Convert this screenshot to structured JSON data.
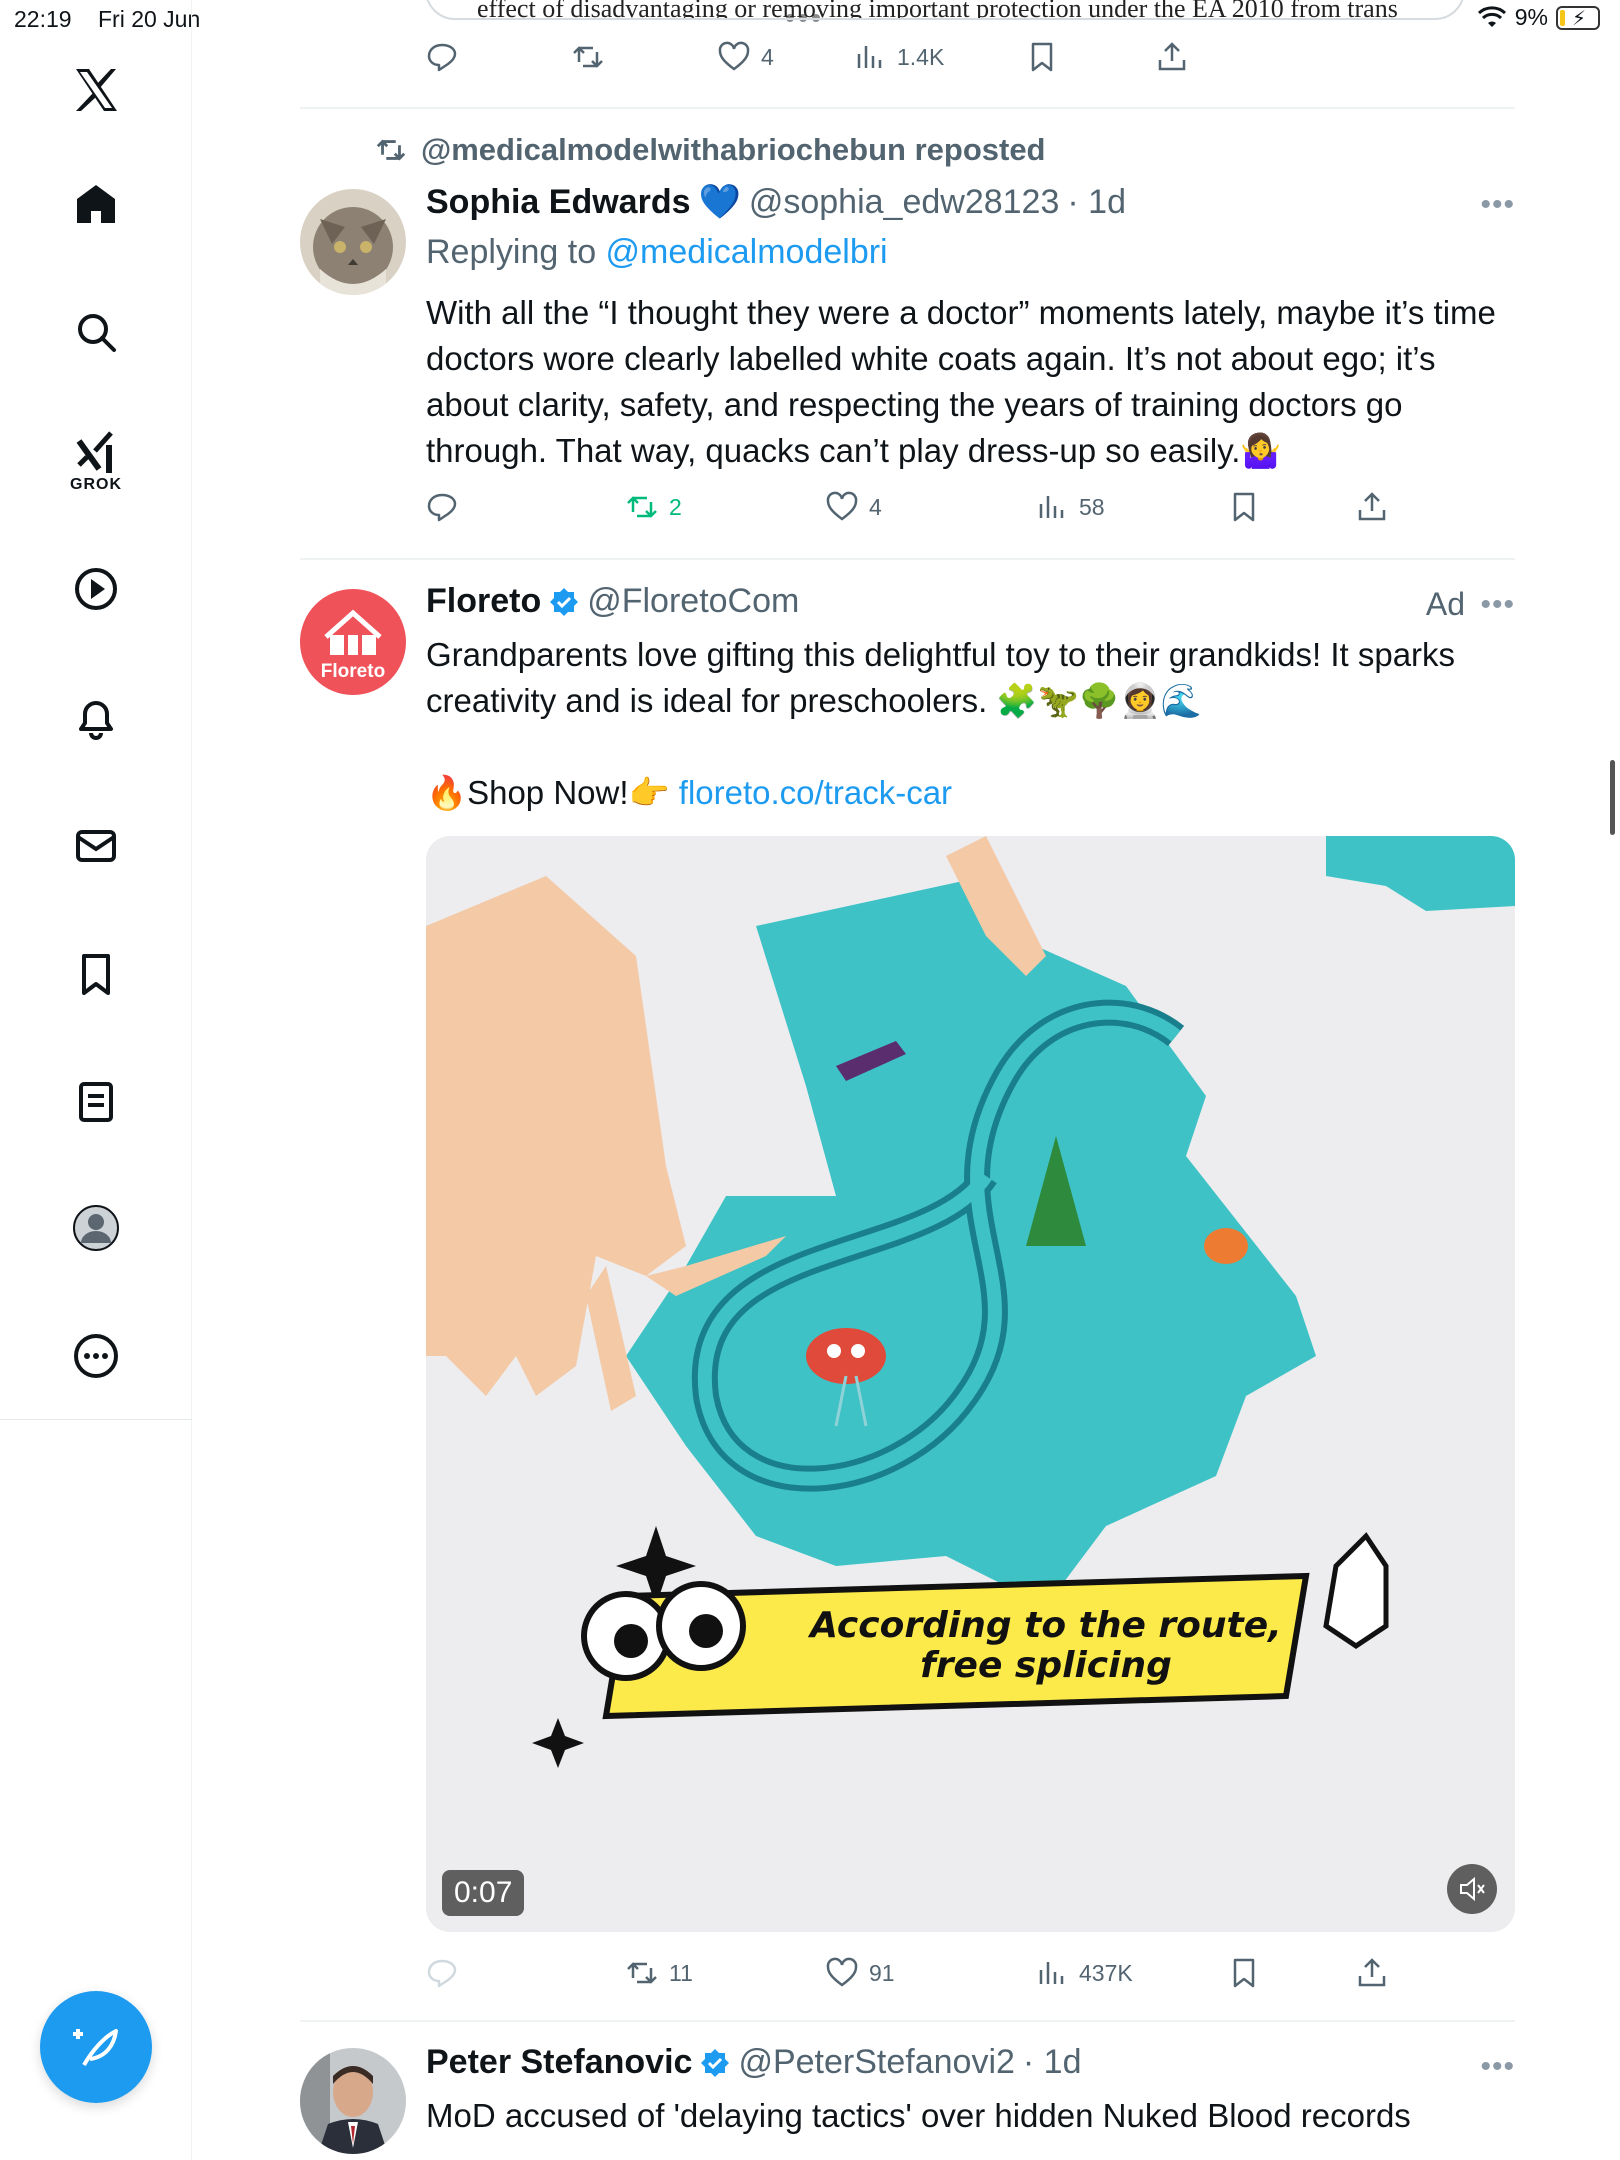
{
  "status_bar": {
    "time": "22:19",
    "date": "Fri 20 Jun",
    "battery": "9%"
  },
  "sidebar": {
    "grok_label": "GROK"
  },
  "previous_tweet": {
    "card_text": "effect of disadvantaging or removing important protection under the EA 2010 from trans",
    "likes": "4",
    "views": "1.4K"
  },
  "tweet1": {
    "reposted_by": "@medicalmodelwithabriochebun reposted",
    "name": "Sophia Edwards",
    "name_emoji": "💙",
    "handle": "@sophia_edw28123",
    "time": "· 1d",
    "replying_prefix": "Replying to ",
    "replying_to": "@medicalmodelbri",
    "text": "With all the “I thought they were a doctor” moments lately, maybe it’s time doctors wore clearly labelled white coats again. It’s not about ego; it’s about clarity, safety, and respecting the years of training doctors go through. That way, quacks can’t play dress-up so easily.🤷‍♀️",
    "reposts": "2",
    "likes": "4",
    "views": "58"
  },
  "ad_tweet": {
    "name": "Floreto",
    "handle": "@FloretoCom",
    "ad_label": "Ad",
    "avatar_text": "Floreto",
    "text": "Grandparents love gifting this delightful toy to their grandkids! It sparks creativity and is ideal for preschoolers. 🧩🦖🌳👩‍🚀🌊",
    "cta": "🔥Shop Now!👉 ",
    "link": "floreto.co/track-car",
    "video_caption": "According to the route, free splicing",
    "video_time": "0:07",
    "reposts": "11",
    "likes": "91",
    "views": "437K"
  },
  "tweet3": {
    "name": "Peter Stefanovic",
    "handle": "@PeterStefanovi2",
    "time": "· 1d",
    "text": "MoD accused of 'delaying tactics' over hidden Nuked Blood records"
  },
  "colors": {
    "accent": "#1d9bf0",
    "repost_green": "#00ba7c",
    "muted": "#536471",
    "floreto_red": "#f0525a",
    "puzzle": "#3fc2c6"
  }
}
